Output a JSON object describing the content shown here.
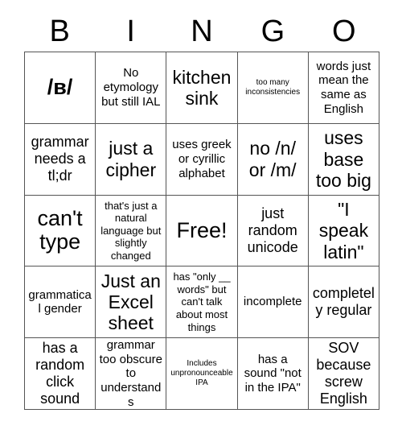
{
  "card": {
    "title_letters": [
      "B",
      "I",
      "N",
      "G",
      "O"
    ],
    "free_space_label": "Free!",
    "colors": {
      "background": "#ffffff",
      "text": "#000000",
      "grid_line": "#555555"
    },
    "grid_size": "5x5",
    "rows": [
      [
        {
          "text": "/в/",
          "size": "xxl",
          "bold": true
        },
        {
          "text": "No etymology but still IAL",
          "size": "m",
          "bold": false
        },
        {
          "text": "kitchen sink",
          "size": "xl",
          "bold": false
        },
        {
          "text": "too many inconsistencies",
          "size": "xs",
          "bold": false
        },
        {
          "text": "words just mean the same as English",
          "size": "m",
          "bold": false
        }
      ],
      [
        {
          "text": "grammar needs a tl;dr",
          "size": "l",
          "bold": false
        },
        {
          "text": "just a cipher",
          "size": "xl",
          "bold": false
        },
        {
          "text": "uses greek or cyrillic alphabet",
          "size": "m",
          "bold": false
        },
        {
          "text": "no /n/ or /m/",
          "size": "xl",
          "bold": false
        },
        {
          "text": "uses base too big",
          "size": "xl",
          "bold": false
        }
      ],
      [
        {
          "text": "can't type",
          "size": "xxl",
          "bold": false
        },
        {
          "text": "that's just a natural language but slightly changed",
          "size": "s",
          "bold": false
        },
        {
          "text": "Free!",
          "size": "xxl",
          "bold": false
        },
        {
          "text": "just random unicode",
          "size": "l",
          "bold": false
        },
        {
          "text": "\"I speak latin\"",
          "size": "xl",
          "bold": false
        }
      ],
      [
        {
          "text": "grammatical gender",
          "size": "m",
          "bold": false
        },
        {
          "text": "Just an Excel sheet",
          "size": "xl",
          "bold": false
        },
        {
          "text": "has \"only __ words\" but can't talk about most things",
          "size": "s",
          "bold": false
        },
        {
          "text": "incomplete",
          "size": "m",
          "bold": false
        },
        {
          "text": "completely regular",
          "size": "l",
          "bold": false
        }
      ],
      [
        {
          "text": "has a random click sound",
          "size": "l",
          "bold": false
        },
        {
          "text": "grammar too obscure to understands",
          "size": "m",
          "bold": false
        },
        {
          "text": "Includes unpronounceable IPA",
          "size": "xs",
          "bold": false
        },
        {
          "text": "has a sound \"not in the IPA\"",
          "size": "m",
          "bold": false
        },
        {
          "text": "SOV because screw English",
          "size": "l",
          "bold": false
        }
      ]
    ]
  }
}
